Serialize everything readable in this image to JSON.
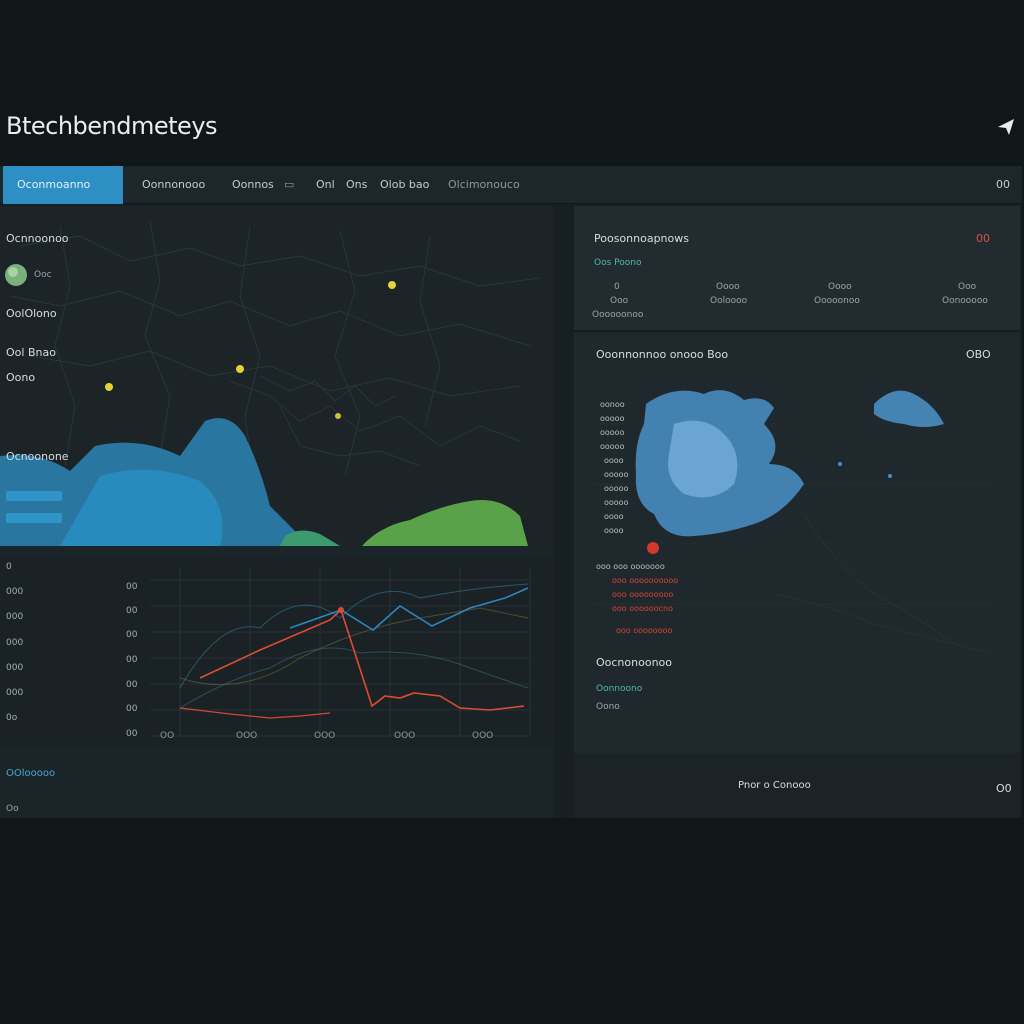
{
  "app": {
    "title": "Btechbendmeteys",
    "send_icon": "send-icon"
  },
  "navbar": {
    "tabs": [
      {
        "label": "Oconmoanno",
        "active": true
      },
      {
        "label": "Oonnonooo"
      },
      {
        "label": "Oonnos"
      },
      {
        "label": "▭"
      },
      {
        "label": "Onl"
      },
      {
        "label": "Ons"
      },
      {
        "label": "Olob bao"
      },
      {
        "label": "Olcimonouco"
      }
    ],
    "right_label": "00"
  },
  "left_panel": {
    "map": {
      "title": "Ocnnoonoo",
      "globe_label": "Ooc",
      "section_1": "OolOlono",
      "section_2": "Ool Bnao",
      "section_3": "Oono",
      "section_4": "Ocnoonone",
      "markers": [
        "yellow",
        "yellow",
        "yellow",
        "yellow"
      ],
      "colors": {
        "water": "#2a8bbf",
        "land_green": "#5aa24a",
        "marker": "#e3d23a"
      }
    },
    "chart": {
      "y_left": [
        "0",
        "000",
        "000",
        "000",
        "000",
        "000",
        "0o"
      ],
      "y_inner": [
        "00",
        "00",
        "00",
        "00",
        "00",
        "00",
        "00"
      ],
      "x_ticks": [
        "OO",
        "OOO",
        "OOO",
        "OOO",
        "OOO",
        "OOO"
      ],
      "footer_label": "OOlooooo",
      "footer_sub": "Oo"
    }
  },
  "right_panel": {
    "stats": {
      "title": "Poosonnoapnows",
      "badge": "00",
      "subtitle": "Oos Poono",
      "columns": [
        {
          "top": "0",
          "bottom": "Ooo"
        },
        {
          "top": "Oooo",
          "bottom": "Ooloooo"
        },
        {
          "top": "Oooo",
          "bottom": "Ooooonoo"
        },
        {
          "top": "Ooo",
          "bottom": "Oonooooo"
        }
      ],
      "footer": "Oooooonoo"
    },
    "weather": {
      "title": "Ooonnonnoo onooo Boo",
      "badge": "OBO",
      "rows_left": [
        "oonoo",
        "ooooo",
        "ooooo",
        "ooooo",
        "oooo",
        "ooooo",
        "ooooo",
        "ooooo",
        "oooo",
        "oooo"
      ],
      "rows_bottom": [
        "ooo ooo ooooooo",
        "ooo oooooooooo",
        "ooo ooooooooo",
        "ooo oooooocno",
        "ooo oooooooo"
      ],
      "section_title": "Oocnonoonoo",
      "section_sub": "Oonnoono",
      "section_sub2": "Oono",
      "colors": {
        "cloud": "#4a90c8",
        "alert": "#d6362b"
      }
    },
    "footer": {
      "label": "Pnor o Conooo",
      "right": "O0"
    }
  }
}
